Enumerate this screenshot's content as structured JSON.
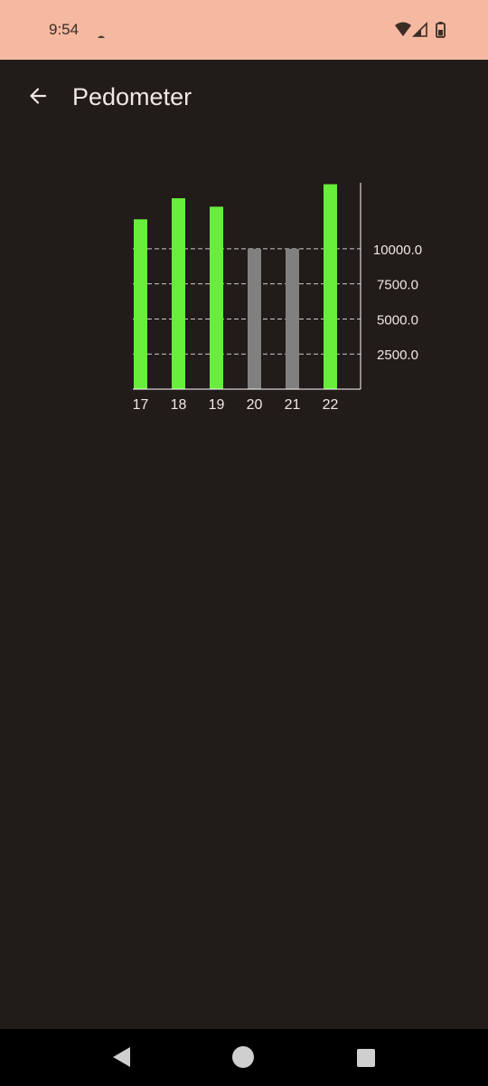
{
  "status_bar": {
    "time": "9:54"
  },
  "app_bar": {
    "title": "Pedometer",
    "back_icon": "arrow-left-icon"
  },
  "colors": {
    "status_bar_bg": "#f4b9a0",
    "background": "#211b19",
    "bar_goal_met": "#66ee3a",
    "bar_goal_missed": "#808080",
    "axis": "#ffffff",
    "text": "#f1e7e3"
  },
  "chart_data": {
    "type": "bar",
    "categories": [
      "17",
      "18",
      "19",
      "20",
      "21",
      "22"
    ],
    "values": [
      12100,
      13600,
      13000,
      10000,
      10000,
      14600
    ],
    "goal_met": [
      true,
      true,
      true,
      false,
      false,
      true
    ],
    "y_ticks": [
      "2500.0",
      "5000.0",
      "7500.0",
      "10000.0"
    ],
    "y_tick_values": [
      2500,
      5000,
      7500,
      10000
    ],
    "ylim": [
      0,
      14700
    ],
    "y_axis_position": "right",
    "grid": "dashed horizontal"
  },
  "nav_bar": {
    "back_icon": "triangle-back-icon",
    "home_icon": "circle-home-icon",
    "recents_icon": "square-recents-icon"
  }
}
